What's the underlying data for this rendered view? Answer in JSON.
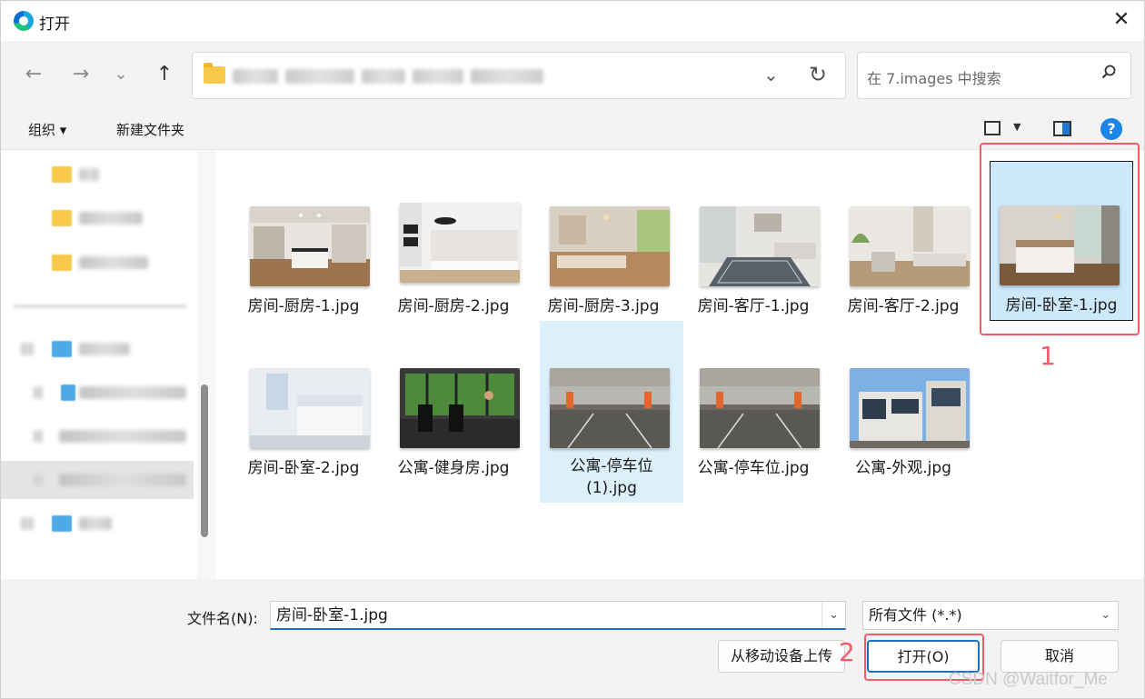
{
  "window": {
    "title": "打开",
    "close_glyph": "✕",
    "app_icon": "edge-browser-icon"
  },
  "nav": {
    "back": "←",
    "forward": "→",
    "recent": "⌄",
    "up": "↑"
  },
  "address": {
    "chevron": "⌄",
    "refresh": "↻"
  },
  "search": {
    "placeholder": "在 7.images 中搜索"
  },
  "toolbar": {
    "organize": "组织 ▾",
    "new_folder": "新建文件夹",
    "help": "?"
  },
  "files": [
    {
      "name": "房间-厨房-1.jpg",
      "thumb": "kitchen-1"
    },
    {
      "name": "房间-厨房-2.jpg",
      "thumb": "kitchen-2"
    },
    {
      "name": "房间-厨房-3.jpg",
      "thumb": "kitchen-3"
    },
    {
      "name": "房间-客厅-1.jpg",
      "thumb": "living-1"
    },
    {
      "name": "房间-客厅-2.jpg",
      "thumb": "living-2"
    },
    {
      "name": "房间-卧室-1.jpg",
      "thumb": "bedroom-1",
      "selected": true
    },
    {
      "name": "房间-卧室-2.jpg",
      "thumb": "bedroom-2"
    },
    {
      "name": "公寓-健身房.jpg",
      "thumb": "gym"
    },
    {
      "name_line1": "公寓-停车位",
      "name_line2": "(1).jpg",
      "thumb": "parking"
    },
    {
      "name": "公寓-停车位.jpg",
      "thumb": "parking"
    },
    {
      "name": "公寓-外观.jpg",
      "thumb": "exterior"
    }
  ],
  "annotations": {
    "step1": "1",
    "step2": "2",
    "color": "#f25c6a"
  },
  "footer": {
    "filename_label": "文件名(N):",
    "filename_value": "房间-卧室-1.jpg",
    "filetype_value": "所有文件 (*.*)",
    "upload_button": "从移动设备上传",
    "open_button": "打开(O)",
    "cancel_button": "取消",
    "caret": "⌄"
  },
  "watermark": "CSDN @Waitfor_Me"
}
